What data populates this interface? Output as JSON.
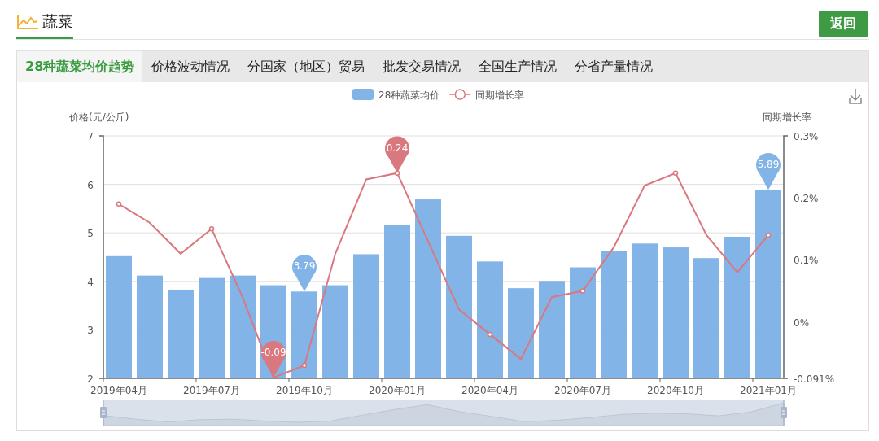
{
  "header": {
    "title": "蔬菜",
    "back_button": "返回"
  },
  "tabs": [
    {
      "label": "28种蔬菜均价趋势",
      "selected": true
    },
    {
      "label": "价格波动情况",
      "selected": false
    },
    {
      "label": "分国家（地区）贸易",
      "selected": false
    },
    {
      "label": "批发交易情况",
      "selected": false
    },
    {
      "label": "全国生产情况",
      "selected": false
    },
    {
      "label": "分省产量情况",
      "selected": false
    }
  ],
  "price_chart": {
    "chart_data": {
      "type": "bar",
      "ylabel": "价格(元/公斤)",
      "grid": true,
      "legend": true,
      "categories": [
        "2019年04月",
        null,
        null,
        "2019年07月",
        null,
        null,
        "2019年10月",
        null,
        null,
        "2020年01月",
        null,
        null,
        "2020年04月",
        null,
        null,
        "2020年07月",
        null,
        null,
        "2020年10月",
        null,
        null,
        "2021年01月"
      ],
      "series": [
        {
          "name": "28种蔬菜均价",
          "color": "#83b4e7",
          "values": [
            4.52,
            4.12,
            3.83,
            4.07,
            4.12,
            3.92,
            3.79,
            3.92,
            4.56,
            5.17,
            5.69,
            4.94,
            4.41,
            3.86,
            4.01,
            4.29,
            4.63,
            4.78,
            4.7,
            4.48,
            4.92,
            5.89
          ]
        }
      ],
      "ylim": [
        2,
        7
      ],
      "yticks": [
        2,
        3,
        4,
        5,
        6,
        7
      ],
      "annotations": [
        "3.79",
        "5.89"
      ]
    }
  },
  "growth_chart": {
    "chart_data": {
      "type": "line",
      "ylabel": "同期增长率",
      "legend": true,
      "series": [
        {
          "name": "同期增长率",
          "color": "#d9787e",
          "values": [
            0.19,
            0.16,
            0.11,
            0.15,
            0.04,
            -0.09,
            -0.07,
            0.11,
            0.23,
            0.24,
            0.13,
            0.02,
            -0.02,
            -0.06,
            0.04,
            0.05,
            0.12,
            0.22,
            0.24,
            0.14,
            0.08,
            0.14
          ]
        }
      ],
      "ylim": [
        -0.091,
        0.3
      ],
      "yticks": [
        {
          "value": -0.091,
          "label": "-0.091%"
        },
        {
          "value": 0,
          "label": "0%"
        },
        {
          "value": 0.1,
          "label": "0.1%"
        },
        {
          "value": 0.2,
          "label": "0.2%"
        },
        {
          "value": 0.3,
          "label": "0.3%"
        }
      ],
      "annotations": [
        "-0.09",
        "0.24"
      ]
    }
  }
}
